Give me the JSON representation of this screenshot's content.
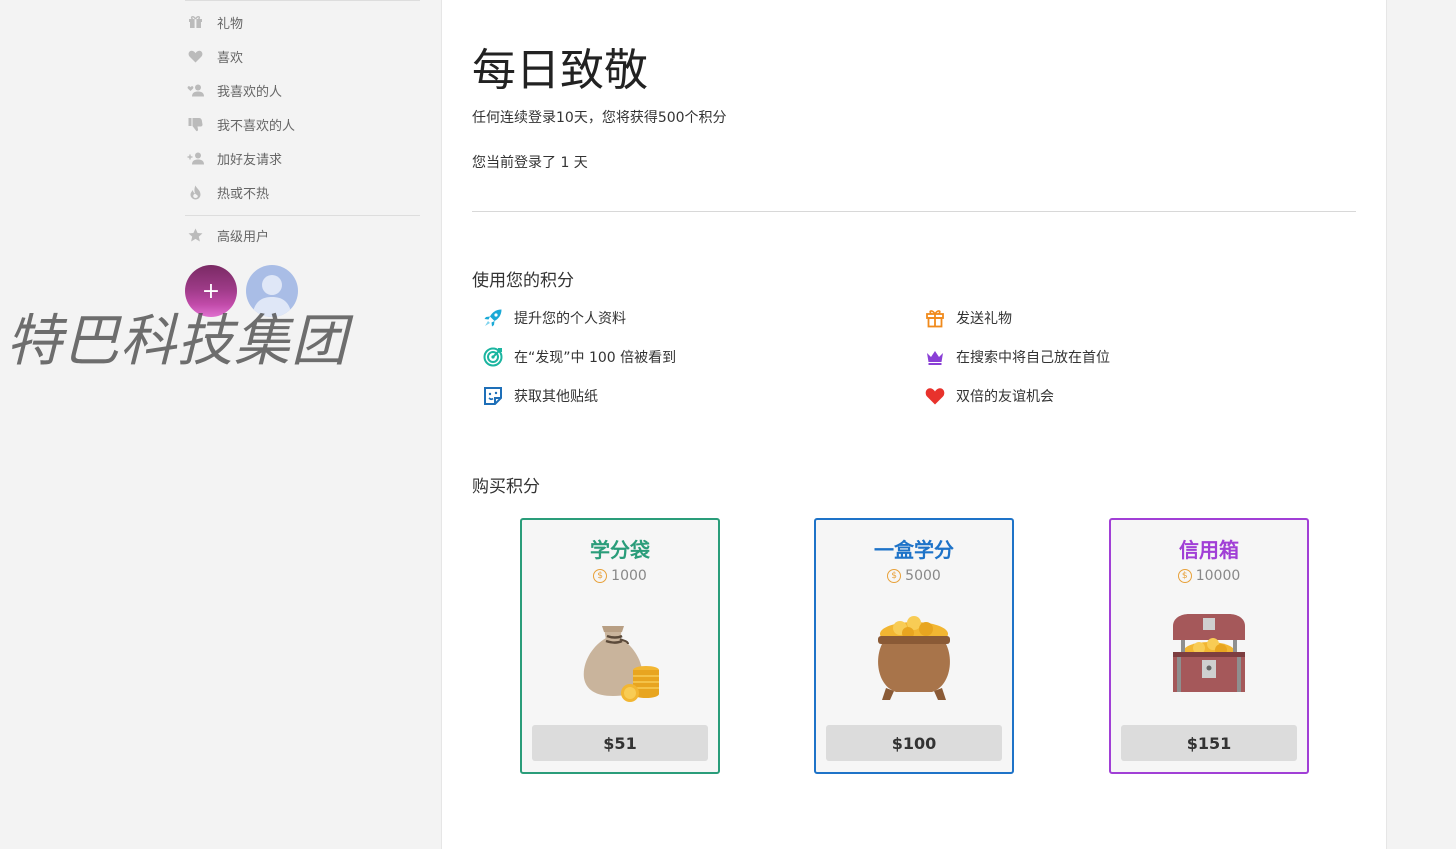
{
  "sidebar": {
    "items": [
      {
        "label": "礼物",
        "icon": "gift-icon"
      },
      {
        "label": "喜欢",
        "icon": "heart-icon"
      },
      {
        "label": "我喜欢的人",
        "icon": "user-heart-icon"
      },
      {
        "label": "我不喜欢的人",
        "icon": "thumbs-down-icon"
      },
      {
        "label": "加好友请求",
        "icon": "user-add-icon"
      },
      {
        "label": "热或不热",
        "icon": "fire-icon"
      },
      {
        "label": "高级用户",
        "icon": "star-icon"
      }
    ],
    "add_photo_label": "+"
  },
  "watermark": "特巴科技集团",
  "main": {
    "title": "每日致敬",
    "desc_reward": "任何连续登录10天，您将获得500个积分",
    "desc_streak": "您当前登录了 1 天",
    "use_points_heading": "使用您的积分",
    "features": [
      {
        "label": "提升您的个人资料",
        "icon": "rocket-icon",
        "color": "#1aa9d6"
      },
      {
        "label": "在“发现”中 100 倍被看到",
        "icon": "target-icon",
        "color": "#1bb5a0"
      },
      {
        "label": "获取其他贴纸",
        "icon": "sticker-icon",
        "color": "#1e6fb8"
      },
      {
        "label": "发送礼物",
        "icon": "gift-icon",
        "color": "#f08a1c"
      },
      {
        "label": "在搜索中将自己放在首位",
        "icon": "crown-icon",
        "color": "#8a3fd6"
      },
      {
        "label": "双倍的友谊机会",
        "icon": "heart-icon",
        "color": "#e8322c"
      }
    ],
    "buy_points_heading": "购买积分",
    "packages": [
      {
        "name": "学分袋",
        "amount": "1000",
        "price": "$51",
        "color": "#2a9d7a",
        "icon": "money-bag-icon"
      },
      {
        "name": "一盒学分",
        "amount": "5000",
        "price": "$100",
        "color": "#1e73c8",
        "icon": "coin-pot-icon"
      },
      {
        "name": "信用箱",
        "amount": "10000",
        "price": "$151",
        "color": "#a13fd6",
        "icon": "treasure-chest-icon"
      }
    ],
    "currency_symbol": "$"
  }
}
